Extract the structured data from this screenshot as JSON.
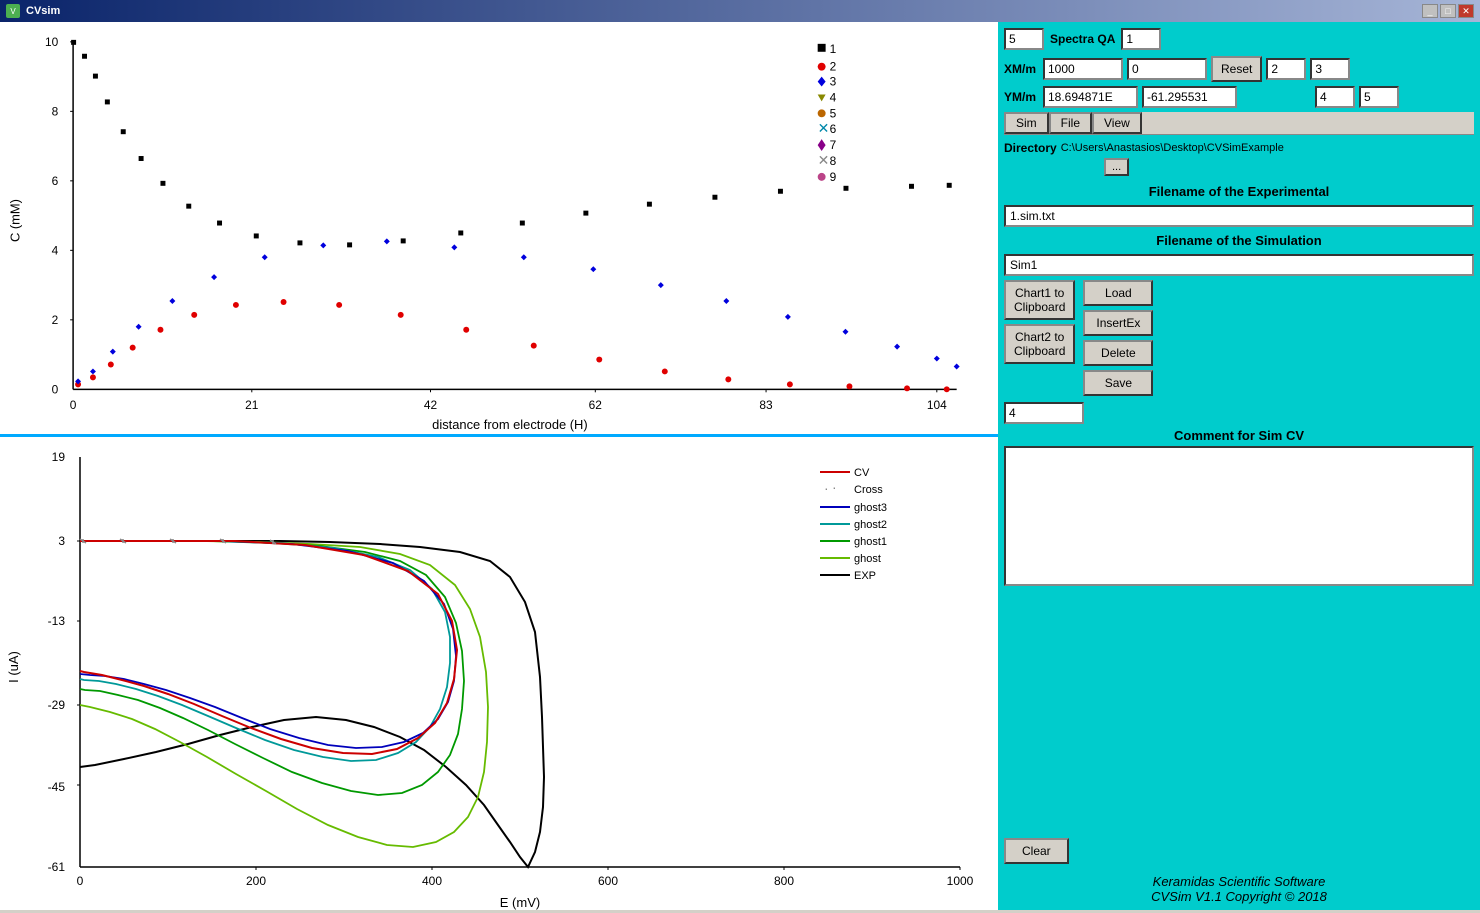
{
  "titlebar": {
    "title": "CVsim",
    "icon": "V"
  },
  "right_panel": {
    "spectra_qa_label": "Spectra QA",
    "spectra_value": "5",
    "spectra_qa_value": "1",
    "xm_label": "XM/m",
    "xm_value1": "1000",
    "xm_value2": "0",
    "ym_label": "YM/m",
    "ym_value1": "18.694871E",
    "ym_value2": "-61.295531",
    "reset_btn": "Reset",
    "num_grid": [
      "2",
      "3",
      "4",
      "5"
    ],
    "menu_sim": "Sim",
    "menu_file": "File",
    "menu_view": "View",
    "directory_label": "Directory",
    "directory_value": "C:\\Users\\Anastasios\\Desktop\\CVSimExample",
    "browse_btn": "...",
    "exp_header": "Filename of the Experimental",
    "exp_filename": "1.sim.txt",
    "sim_header": "Filename of the Simulation",
    "sim_filename": "Sim1",
    "chart1_btn": "Chart1 to\nClipboard",
    "chart2_btn": "Chart2 to\nClipboard",
    "load_btn": "Load",
    "insertex_btn": "InsertEx",
    "delete_btn": "Delete",
    "save_btn": "Save",
    "sim_number": "4",
    "comment_label": "Comment for Sim CV",
    "clear_btn": "Clear",
    "footer1": "Keramidas Scientific Software",
    "footer2": "CVSim V1.1 Copyright © 2018"
  },
  "chart_top": {
    "y_label": "C (mM)",
    "x_label": "distance from electrode (H)",
    "y_ticks": [
      "10",
      "8",
      "6",
      "4",
      "2",
      "0"
    ],
    "x_ticks": [
      "0",
      "21",
      "42",
      "62",
      "83",
      "104"
    ],
    "legend": [
      {
        "id": "1",
        "marker": "■",
        "color": "#000000"
      },
      {
        "id": "2",
        "marker": "●",
        "color": "#e00000"
      },
      {
        "id": "3",
        "marker": "♦",
        "color": "#0000dd"
      },
      {
        "id": "4",
        "marker": "▲",
        "color": "#888800"
      },
      {
        "id": "5",
        "marker": "●",
        "color": "#bb6600"
      },
      {
        "id": "6",
        "marker": "✕",
        "color": "#0088aa"
      },
      {
        "id": "7",
        "marker": "♦",
        "color": "#880088"
      },
      {
        "id": "8",
        "marker": "✕",
        "color": "#888888"
      },
      {
        "id": "9",
        "marker": "●",
        "color": "#bb4488"
      }
    ]
  },
  "chart_bottom": {
    "y_label": "I (uA)",
    "x_label": "E (mV)",
    "y_ticks": [
      "19",
      "3",
      "-13",
      "-29",
      "-45",
      "-61"
    ],
    "x_ticks": [
      "0",
      "200",
      "400",
      "600",
      "800",
      "1000"
    ],
    "legend": [
      {
        "id": "CV",
        "color": "#cc0000"
      },
      {
        "id": "Cross",
        "color": "#888888"
      },
      {
        "id": "ghost3",
        "color": "#000088"
      },
      {
        "id": "ghost2",
        "color": "#006666"
      },
      {
        "id": "ghost1",
        "color": "#008800"
      },
      {
        "id": "ghost",
        "color": "#44aa00"
      },
      {
        "id": "EXP",
        "color": "#000000"
      }
    ]
  }
}
